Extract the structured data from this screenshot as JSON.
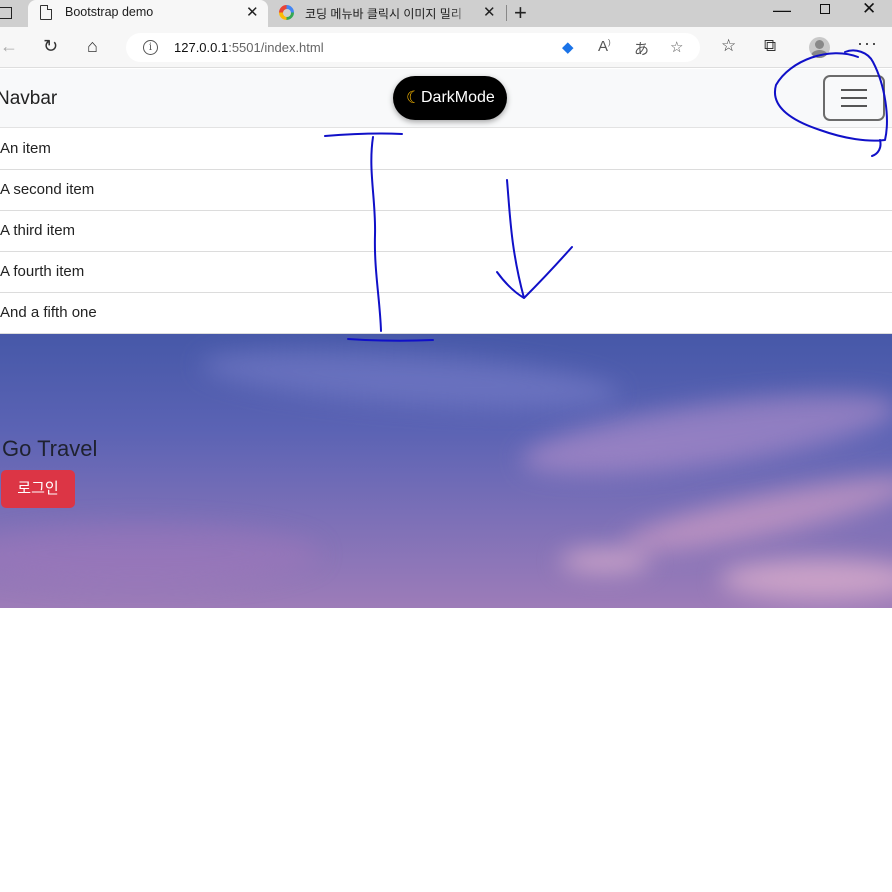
{
  "browser": {
    "tabs": [
      {
        "title": "Bootstrap demo",
        "active": true,
        "icon": "page-icon"
      },
      {
        "title": "코딩 메뉴바 클릭시 이미지 밀리",
        "active": false,
        "icon": "google-icon"
      }
    ],
    "close_glyph": "✕",
    "new_tab_glyph": "+",
    "url_host": "127.0.0.1",
    "url_path": ":5501/index.html"
  },
  "page": {
    "brand": "Navbar",
    "darkmode_label": "DarkMode",
    "list_items": [
      "An item",
      "A second item",
      "A third item",
      "A fourth item",
      "And a fifth one"
    ],
    "hero_title": "Go Travel",
    "login_label": "로그인"
  },
  "colors": {
    "login_button": "#dc3545",
    "darkmode_button": "#000000",
    "annotation_ink": "#1010c8"
  }
}
